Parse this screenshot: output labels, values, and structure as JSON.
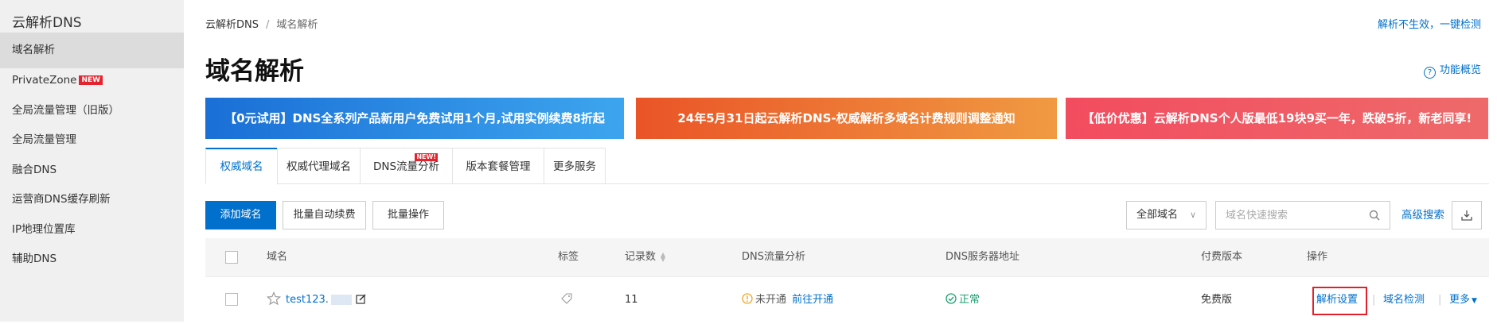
{
  "sidebar": {
    "title": "云解析DNS",
    "items": [
      {
        "label": "域名解析"
      },
      {
        "label": "PrivateZone",
        "badge": "NEW"
      },
      {
        "label": "全局流量管理（旧版）"
      },
      {
        "label": "全局流量管理"
      },
      {
        "label": "融合DNS"
      },
      {
        "label": "运营商DNS缓存刷新"
      },
      {
        "label": "IP地理位置库"
      },
      {
        "label": "辅助DNS"
      }
    ]
  },
  "header": {
    "breadcrumb": [
      "云解析DNS",
      "域名解析"
    ],
    "separator": "/",
    "topright_link": "解析不生效，一键检测",
    "title": "域名解析",
    "feature_link": "功能概览"
  },
  "banners": [
    "【0元试用】DNS全系列产品新用户免费试用1个月,试用实例续费8折起",
    "24年5月31日起云解析DNS-权威解析多域名计费规则调整通知",
    "【低价优惠】云解析DNS个人版最低19块9买一年，跌破5折，新老同享!"
  ],
  "tabs": [
    {
      "label": "权威域名"
    },
    {
      "label": "权威代理域名"
    },
    {
      "label": "DNS流量分析",
      "badge": "NEW!"
    },
    {
      "label": "版本套餐管理"
    },
    {
      "label": "更多服务"
    }
  ],
  "toolbar": {
    "add_domain": "添加域名",
    "batch_renew": "批量自动续费",
    "batch_ops": "批量操作",
    "domain_filter": "全部域名",
    "search_placeholder": "域名快速搜索",
    "advanced_search": "高级搜索"
  },
  "table": {
    "columns": [
      "域名",
      "标签",
      "记录数",
      "DNS流量分析",
      "DNS服务器地址",
      "付费版本",
      "操作"
    ],
    "rows": [
      {
        "domain_prefix": "test123.",
        "record_count": "11",
        "traffic_status": "未开通",
        "traffic_link": "前往开通",
        "dns_status": "正常",
        "edition": "免费版",
        "actions": [
          "解析设置",
          "域名检测",
          "更多"
        ]
      }
    ]
  },
  "colors": {
    "primary": "#0070cc",
    "highlight": "#e0212b",
    "warning": "#f5a623",
    "success": "#1aa06d"
  },
  "icons": [
    "help-icon",
    "search-icon",
    "export-icon",
    "star-icon",
    "edit-icon",
    "tag-icon",
    "warning-icon",
    "check-circle-icon",
    "caret-down-icon"
  ]
}
